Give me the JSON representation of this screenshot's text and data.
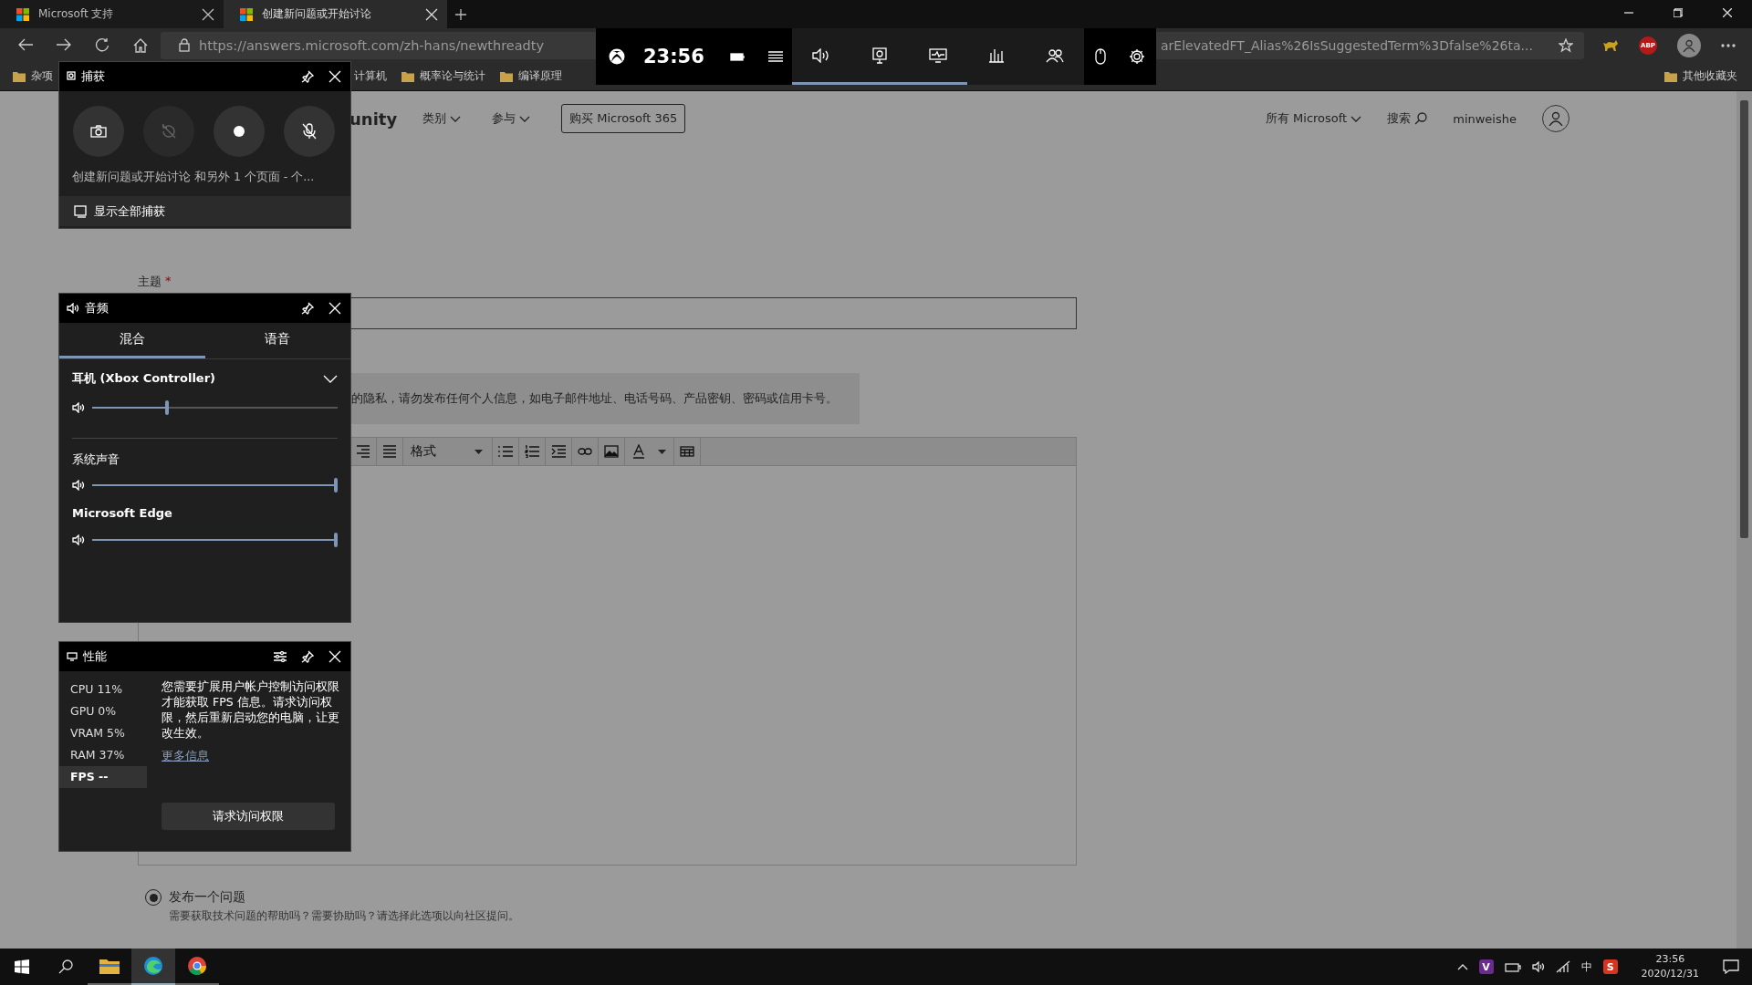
{
  "browser": {
    "tabs": [
      {
        "title": "Microsoft 支持",
        "selected": false
      },
      {
        "title": "创建新问题或开始讨论",
        "selected": true
      }
    ],
    "url_start": "https://answers.microsoft.com/zh-hans/newthreadty",
    "url_end": "arElevatedFT_Alias%26IsSuggestedTerm%3Dfalse%26ta...",
    "adblock_label": "ABP",
    "bookmarks": [
      "杂项",
      "计算机",
      "概率论与统计",
      "编译原理"
    ],
    "other_bookmarks": "其他收藏夹"
  },
  "page": {
    "brand": "unity",
    "nav": [
      "类别",
      "参与"
    ],
    "buy_button": "购买 Microsoft 365",
    "right_nav": [
      {
        "label": "所有 Microsoft",
        "kind": "dropdown"
      },
      {
        "label": "搜索",
        "kind": "search"
      }
    ],
    "user": "minweishe",
    "subject_label": "主题",
    "required_mark": "*",
    "privacy_notice": "的隐私，请勿发布任何个人信息，如电子邮件地址、电话号码、产品密钥、密码或信用卡号。",
    "format_select": "格式",
    "post_options": [
      {
        "label": "发布一个问题",
        "description": "需要获取技术问题的帮助吗？需要协助吗？请选择此选项以向社区提问。",
        "selected": true
      }
    ]
  },
  "game_bar": {
    "time": "23:56",
    "widgets": [
      {
        "kind": "audio",
        "active": true
      },
      {
        "kind": "capture",
        "active": true
      },
      {
        "kind": "performance",
        "active": true
      },
      {
        "kind": "resources",
        "active": false
      },
      {
        "kind": "social",
        "active": false
      }
    ]
  },
  "capture": {
    "title": "捕获",
    "buttons": [
      {
        "kind": "screenshot",
        "disabled": false
      },
      {
        "kind": "record-last",
        "disabled": true
      },
      {
        "kind": "record",
        "disabled": false
      },
      {
        "kind": "mic",
        "disabled": false
      }
    ],
    "recent": "创建新问题或开始讨论 和另外 1 个页面 - 个...",
    "show_all": "显示全部捕获"
  },
  "audio": {
    "title": "音频",
    "tabs": [
      {
        "label": "混合",
        "selected": true
      },
      {
        "label": "语音",
        "selected": false
      }
    ],
    "device": {
      "name": "耳机 (Xbox Controller)",
      "level": 0.3
    },
    "apps": [
      {
        "name": "系统声音",
        "level": 1
      },
      {
        "name": "Microsoft Edge",
        "level": 1
      }
    ]
  },
  "performance": {
    "title": "性能",
    "metrics": [
      {
        "text": "CPU 11%",
        "selected": false
      },
      {
        "text": "GPU 0%",
        "selected": false
      },
      {
        "text": "VRAM 5%",
        "selected": false
      },
      {
        "text": "RAM 37%",
        "selected": false
      },
      {
        "text": "FPS --",
        "selected": true
      }
    ],
    "message": "您需要扩展用户帐户控制访问权限才能获取 FPS 信息。请求访问权限，然后重新启动您的电脑，让更改生效。",
    "more_info": "更多信息",
    "request_button": "请求访问权限"
  },
  "taskbar": {
    "apps": [
      {
        "kind": "explorer",
        "active": false
      },
      {
        "kind": "edge",
        "active": true
      },
      {
        "kind": "chrome",
        "active": false
      }
    ],
    "tray_apps": [
      "V",
      "S"
    ],
    "ime": "中",
    "time": "23:56",
    "date": "2020/12/31"
  }
}
